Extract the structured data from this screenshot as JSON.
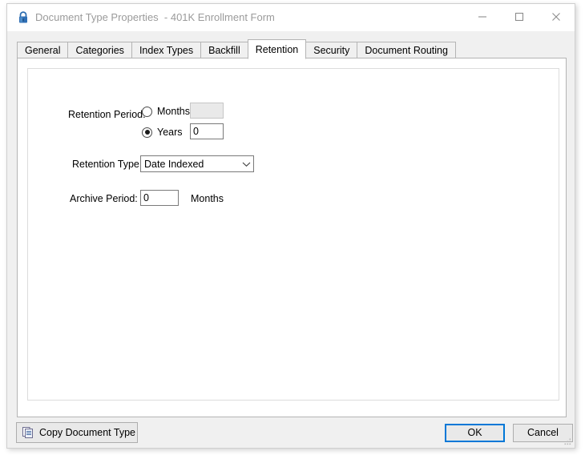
{
  "window": {
    "title": "Document Type Properties  - 401K Enrollment Form",
    "icon": "lock-icon",
    "controls": {
      "minimize": "minimize-icon",
      "maximize": "maximize-icon",
      "close": "close-icon"
    }
  },
  "tabs": [
    {
      "label": "General",
      "selected": false
    },
    {
      "label": "Categories",
      "selected": false
    },
    {
      "label": "Index Types",
      "selected": false
    },
    {
      "label": "Backfill",
      "selected": false
    },
    {
      "label": "Retention",
      "selected": true
    },
    {
      "label": "Security",
      "selected": false
    },
    {
      "label": "Document Routing",
      "selected": false
    }
  ],
  "retention_tab": {
    "retention_period": {
      "label": "Retention Period:",
      "options": [
        {
          "label": "Months",
          "selected": false,
          "value": "",
          "enabled": false
        },
        {
          "label": "Years",
          "selected": true,
          "value": "0",
          "enabled": true
        }
      ]
    },
    "retention_type": {
      "label": "Retention Type:",
      "value": "Date Indexed",
      "options": [
        "Date Indexed"
      ]
    },
    "archive_period": {
      "label": "Archive Period:",
      "value": "0",
      "units": "Months"
    }
  },
  "footer": {
    "copy_document_type": "Copy Document Type",
    "ok": "OK",
    "cancel": "Cancel"
  },
  "colors": {
    "accent": "#0078d7",
    "title_text": "#9b9b9b",
    "window_bg": "#f0f0f0",
    "panel_bg": "#ffffff",
    "border": "#b4b4b4",
    "lock_icon": "#2b6cb0"
  }
}
